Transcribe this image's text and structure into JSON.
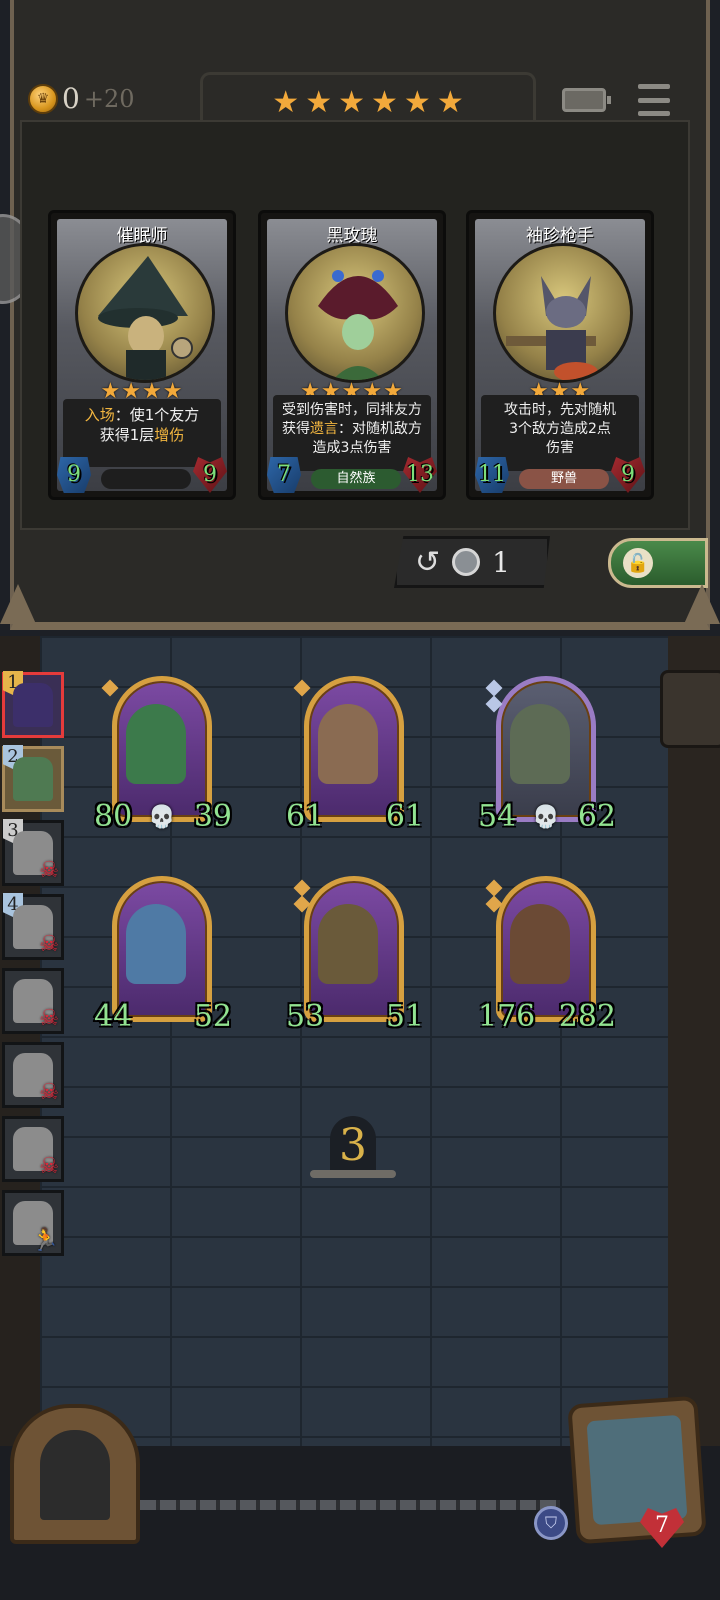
{
  "header": {
    "gold": "0",
    "gold_income": "+20",
    "tavern_stars": 6,
    "star_glyph": "★"
  },
  "shop": {
    "cards": [
      {
        "name": "催眠师",
        "stars": 4,
        "desc_line1_keyword": "入场",
        "desc_line1_text": "：使1个友方",
        "desc_line2_text": "获得1层",
        "desc_line2_keyword": "增伤",
        "attack": "9",
        "health": "9",
        "tribe": ""
      },
      {
        "name": "黑玫瑰",
        "stars": 5,
        "desc_line1": "受到伤害时，同排友方",
        "desc_line2_prefix": "获得",
        "desc_line2_keyword": "遗言",
        "desc_line2_suffix": "：对随机敌方",
        "desc_line3": "造成3点伤害",
        "attack": "7",
        "health": "13",
        "tribe": "自然族"
      },
      {
        "name": "袖珍枪手",
        "stars": 3,
        "desc_line1": "攻击时，先对随机",
        "desc_line2": "3个敌方造成2点",
        "desc_line3": "伤害",
        "attack": "11",
        "health": "9",
        "tribe": "野兽"
      }
    ],
    "refresh_cost": "1"
  },
  "opponents": [
    {
      "rank": "1",
      "state": "active"
    },
    {
      "rank": "2",
      "state": "me"
    },
    {
      "rank": "3",
      "state": "dead"
    },
    {
      "rank": "4",
      "state": "dead"
    },
    {
      "rank": "",
      "state": "dead"
    },
    {
      "rank": "",
      "state": "dead"
    },
    {
      "rank": "",
      "state": "dead"
    },
    {
      "rank": "",
      "state": "dead"
    }
  ],
  "board": {
    "minions": [
      {
        "attack": "80",
        "health": "39",
        "skull": true,
        "tier": "gold"
      },
      {
        "attack": "61",
        "health": "61",
        "skull": false,
        "tier": "gold"
      },
      {
        "attack": "54",
        "health": "62",
        "skull": true,
        "tier": "silver"
      },
      {
        "attack": "44",
        "health": "52",
        "skull": false,
        "tier": "gold"
      },
      {
        "attack": "53",
        "health": "51",
        "skull": false,
        "tier": "gold"
      },
      {
        "attack": "176",
        "health": "282",
        "skull": false,
        "tier": "gold"
      }
    ],
    "turn": "3"
  },
  "hero": {
    "health": "7"
  },
  "colors": {
    "star": "#f2a93b",
    "stat_green": "#92e391",
    "keyword": "#f2b640",
    "danger": "#e0273a"
  }
}
